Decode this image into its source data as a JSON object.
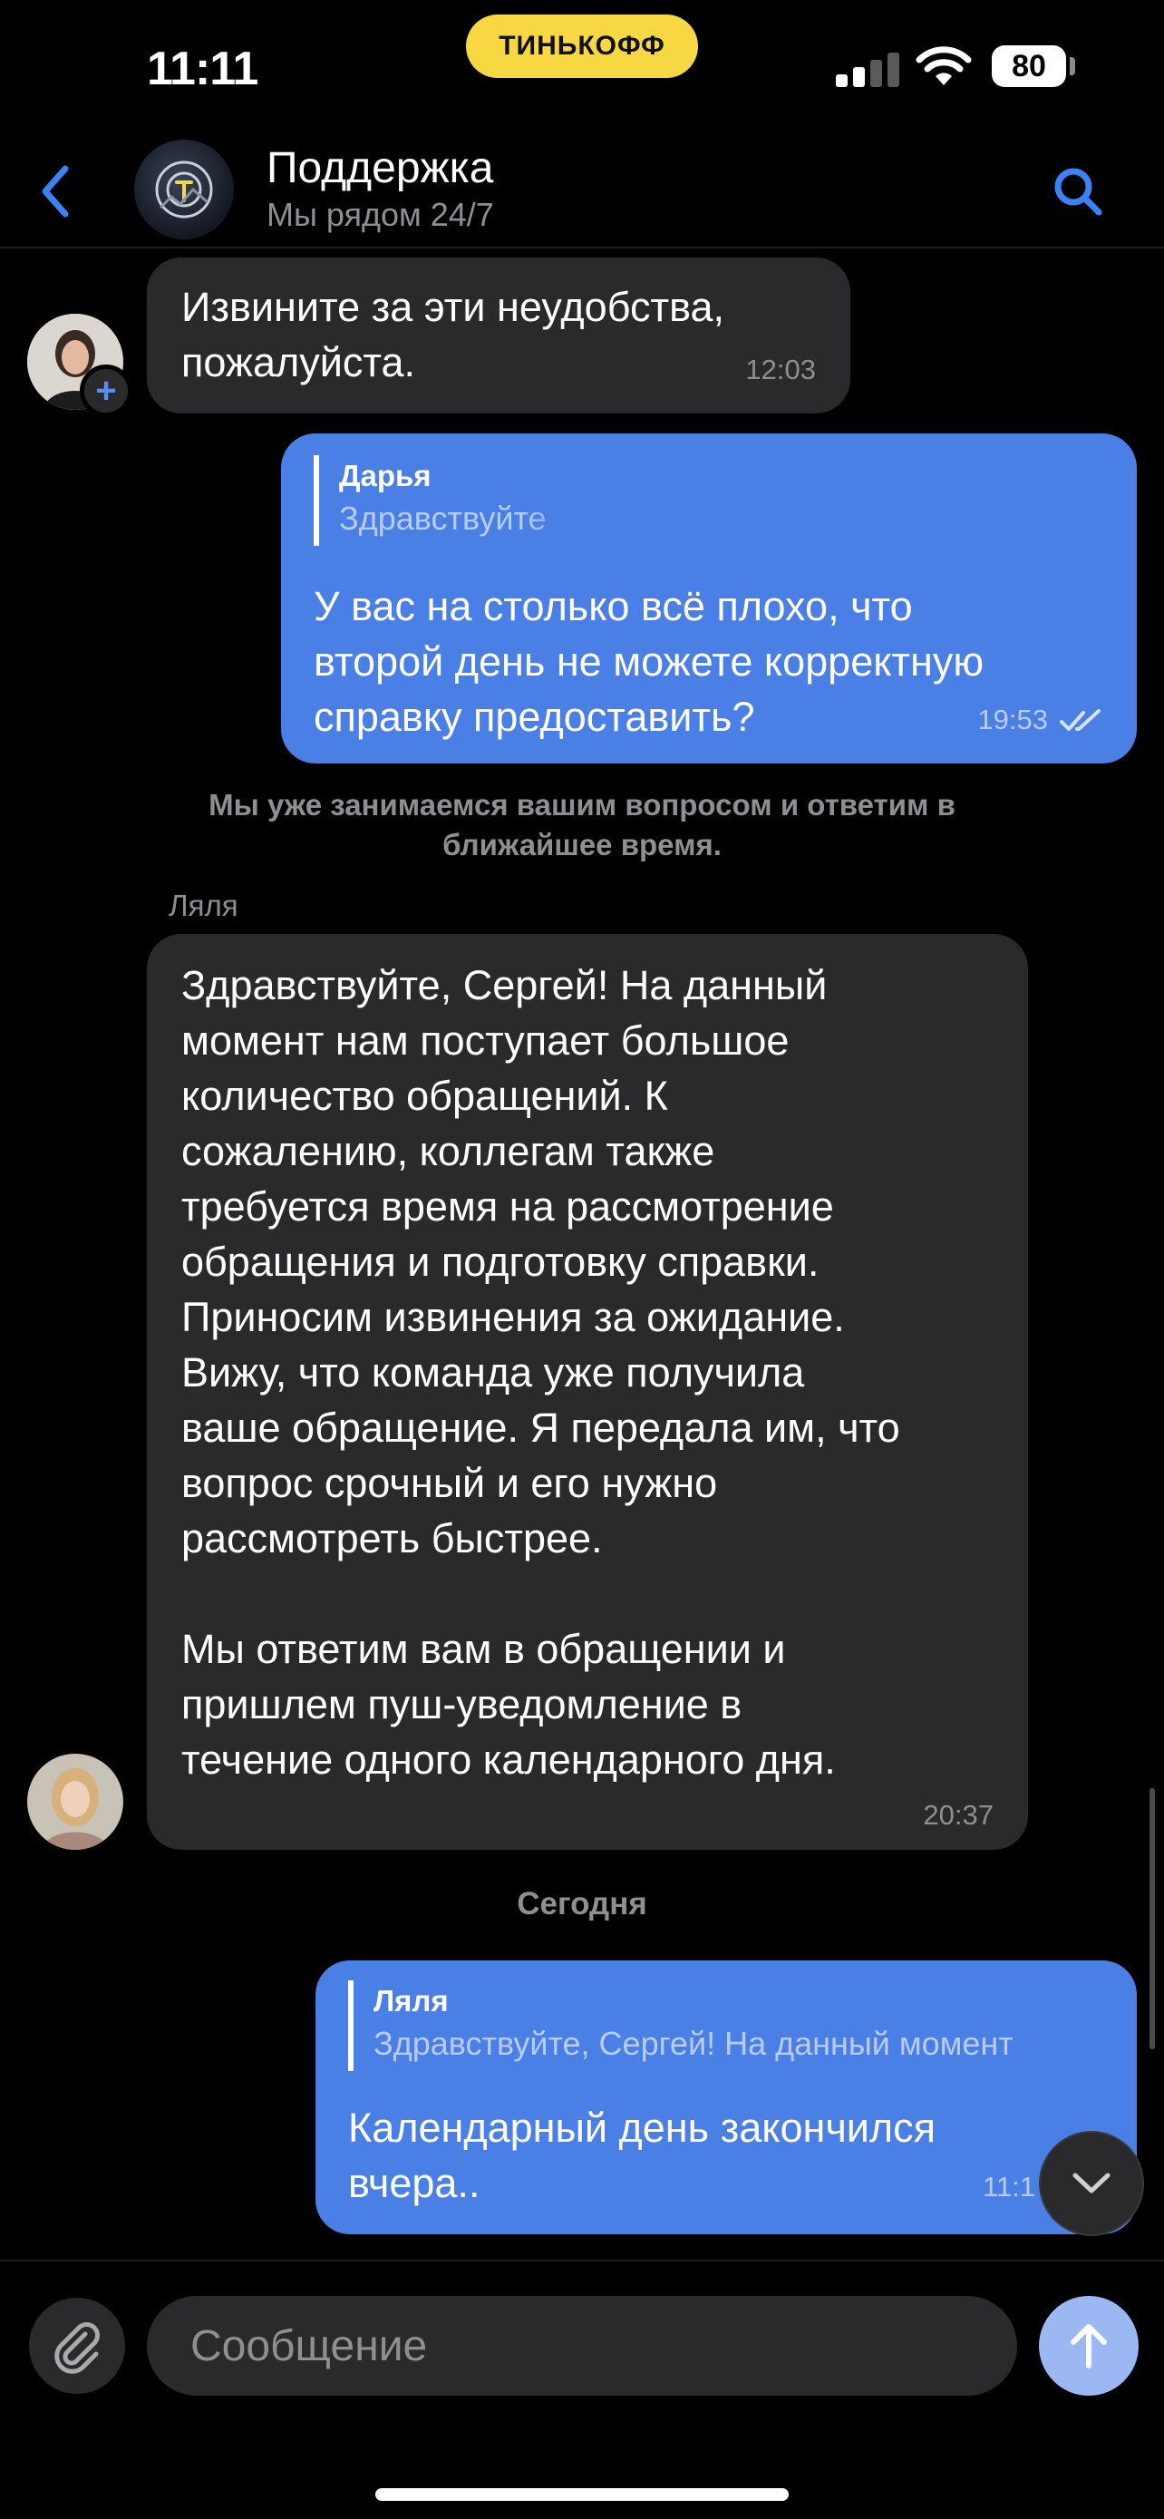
{
  "status_bar": {
    "time": "11:11",
    "carrier_badge": "ТИНЬКОФФ",
    "battery": "80",
    "signal_icon": "cellular-signal-icon",
    "wifi_icon": "wifi-icon"
  },
  "header": {
    "title": "Поддержка",
    "subtitle": "Мы рядом 24/7",
    "back_icon": "chevron-left-icon",
    "search_icon": "search-icon"
  },
  "messages": [
    {
      "direction": "incoming",
      "lines": [
        "Извините за эти неудобства,",
        "пожалуйста."
      ],
      "time": "12:03"
    },
    {
      "direction": "outgoing",
      "reply": {
        "name": "Дарья",
        "text": "Здравствуйте"
      },
      "lines": [
        "У вас на столько всё плохо, что",
        "второй день не можете корректную",
        "справку предоставить?"
      ],
      "time": "19:53",
      "status_icon": "double-check-icon"
    },
    {
      "direction": "incoming",
      "sender": "Ляля",
      "lines": [
        "Здравствуйте, Сергей! На данный",
        "момент нам поступает большое",
        "количество обращений. К",
        "сожалению, коллегам также",
        "требуется время на рассмотрение",
        "обращения и подготовку справки.",
        "Приносим извинения за ожидание.",
        "Вижу, что команда уже получила",
        "ваше обращение. Я передала им, что",
        "вопрос срочный и его нужно",
        "рассмотреть быстрее.",
        "",
        "Мы ответим вам в обращении и",
        "пришлем пуш-уведомление в",
        "течение одного календарного дня."
      ],
      "time": "20:37"
    },
    {
      "direction": "outgoing",
      "reply": {
        "name": "Ляля",
        "text": "Здравствуйте, Сергей! На данный момент"
      },
      "lines": [
        "Календарный день закончился",
        "вчера.."
      ],
      "time": "11:1"
    }
  ],
  "system_note": "Мы уже занимаемся вашим вопросом и ответим в ближайшее время.",
  "date_divider": "Сегодня",
  "input": {
    "placeholder": "Сообщение",
    "attach_icon": "paperclip-icon",
    "send_icon": "arrow-up-icon"
  },
  "colors": {
    "background": "#000000",
    "incoming_bubble": "#2a2a2c",
    "outgoing_bubble": "#4a7fe6",
    "accent": "#3b82f6",
    "secondary_text": "#8e8e93",
    "badge": "#f7d842"
  }
}
